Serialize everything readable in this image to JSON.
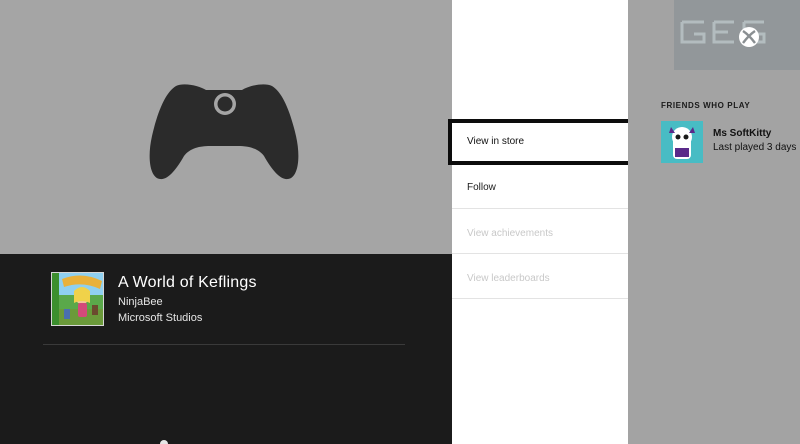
{
  "game": {
    "title": "A World of Keflings",
    "developer": "NinjaBee",
    "publisher": "Microsoft Studios"
  },
  "menu": {
    "items": [
      {
        "label": "View in store",
        "enabled": true,
        "focused": true
      },
      {
        "label": "Follow",
        "enabled": true,
        "focused": false
      },
      {
        "label": "View achievements",
        "enabled": false,
        "focused": false
      },
      {
        "label": "View leaderboards",
        "enabled": false,
        "focused": false
      }
    ]
  },
  "friends": {
    "header": "FRIENDS WHO PLAY",
    "list": [
      {
        "name": "Ms SoftKitty",
        "status": "Last played 3 days"
      }
    ]
  },
  "icons": {
    "controller": "controller-icon",
    "xbox": "xbox-logo-icon"
  },
  "colors": {
    "background": "#a3a3a3",
    "dark_panel": "#1b1b1b",
    "menu_bg": "#ffffff",
    "focus_border": "#0c0c0c",
    "avatar_bg": "#48bcc4"
  }
}
